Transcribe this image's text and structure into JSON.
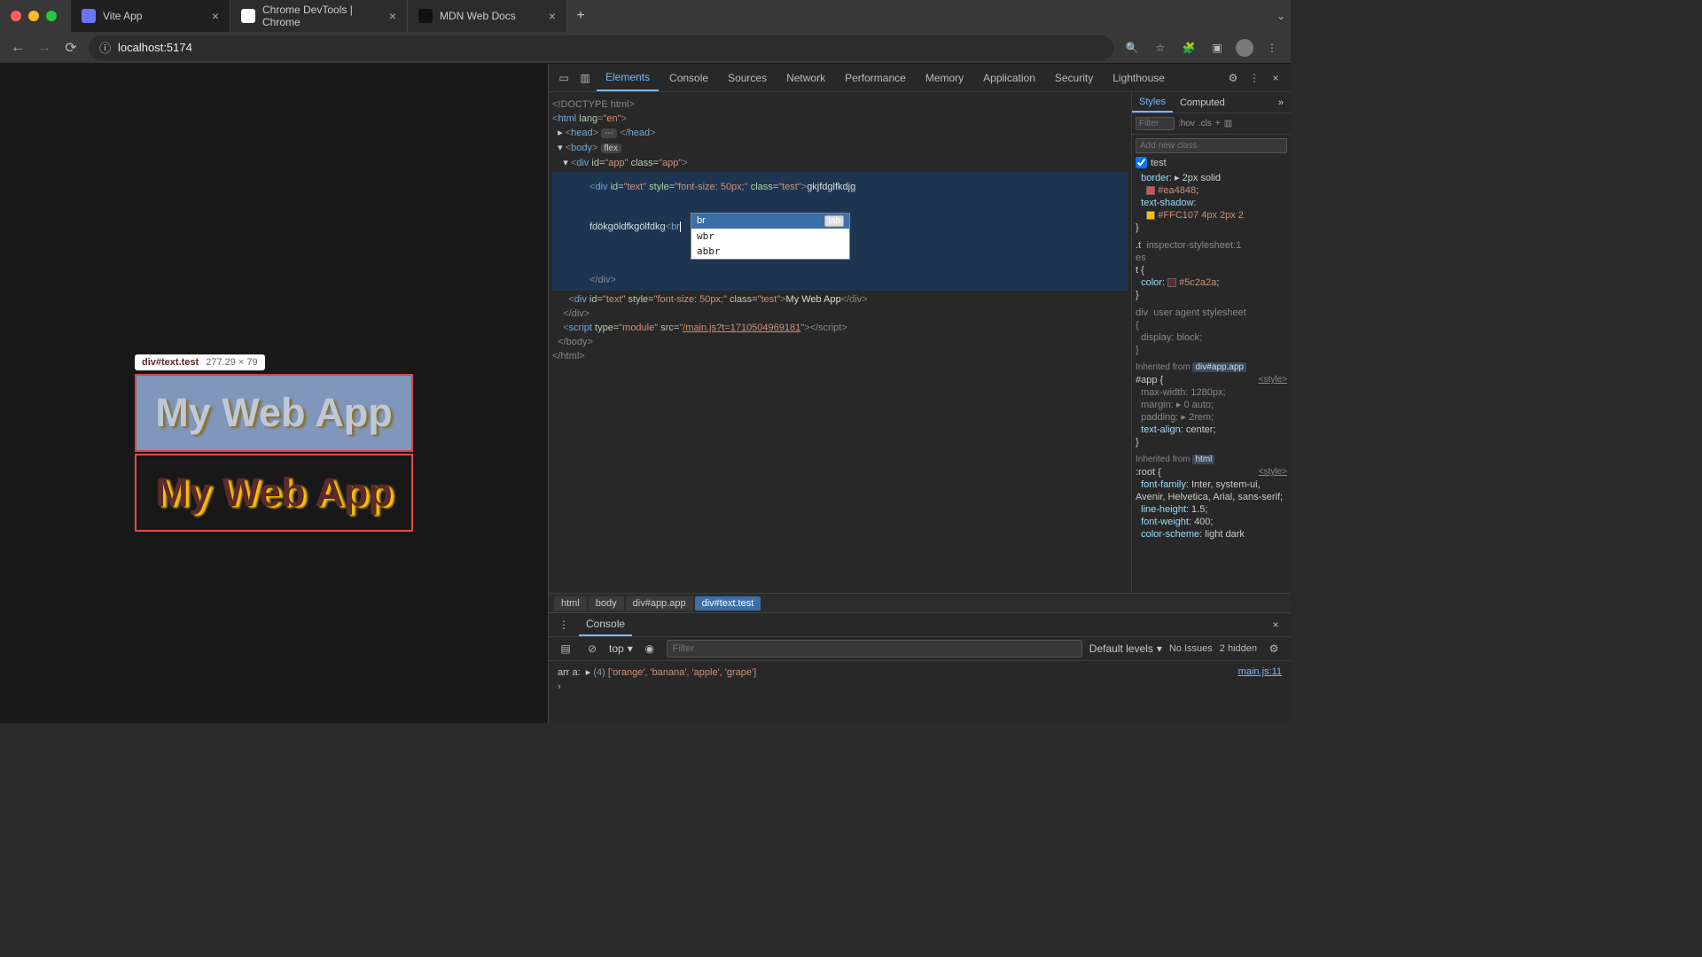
{
  "browser": {
    "tabs": [
      {
        "title": "Vite App",
        "favicon": "#6875f5"
      },
      {
        "title": "Chrome DevTools | Chrome",
        "favicon": "#66aa66"
      },
      {
        "title": "MDN Web Docs",
        "favicon": "#222"
      }
    ],
    "url": "localhost:5174"
  },
  "page_preview": {
    "hover_selector": "div#text.test",
    "hover_dims": "277.29 × 79",
    "text1": "My Web App",
    "text2": "My Web App"
  },
  "devtools": {
    "panels": [
      "Elements",
      "Console",
      "Sources",
      "Network",
      "Performance",
      "Memory",
      "Application",
      "Security",
      "Lighthouse"
    ],
    "active_panel": "Elements",
    "dom": {
      "doctype": "<!DOCTYPE html>",
      "html_open": "html",
      "html_lang": "en",
      "head_label": "head",
      "body_label": "body",
      "flex_badge": "flex",
      "app_id": "app",
      "app_class": "app",
      "text_id": "text",
      "text_style": "font-size: 50px;",
      "text_class": "test",
      "text_content_1": "gkjfdglfkdjg",
      "edit_prefix": "fdökgöldfkgölfdkg",
      "edit_typed": "br",
      "close_div": "</div>",
      "second_text_content": "My Web App",
      "script_type": "module",
      "script_src": "/main.js?t=1710504969181"
    },
    "autocomplete": {
      "selected": "br",
      "opt2": "wbr",
      "opt3": "abbr",
      "hint": "tab"
    },
    "breadcrumbs": [
      "html",
      "body",
      "div#app.app",
      "div#text.test"
    ],
    "styles_sidebar": {
      "tabs": [
        "Styles",
        "Computed"
      ],
      "filter_placeholder": "Filter",
      "hov": ":hov",
      "cls": ".cls",
      "newclass_placeholder": "Add new class",
      "class_checkbox": "test",
      "rule_test": {
        "border_prop": "border",
        "border_val_a": "2px solid",
        "border_val_b": "#ea4848",
        "shadow_prop": "text-shadow",
        "shadow_val": "#FFC107 4px 2px 2"
      },
      "rule_t": {
        "selector": ".t",
        "source": "inspector-stylesheet:1",
        "es": "es",
        "color_prop": "color",
        "color_val": "#5c2a2a"
      },
      "rule_div": {
        "selector": "div",
        "note": "user agent stylesheet",
        "prop": "display",
        "val": "block"
      },
      "inherited_app": {
        "label": "Inherited from",
        "link": "div#app.app",
        "selector": "#app",
        "source": "<style>",
        "mw_prop": "max-width",
        "mw_val": "1280px",
        "mg_prop": "margin",
        "mg_val": "0 auto",
        "pd_prop": "padding",
        "pd_val": "2rem",
        "ta_prop": "text-align",
        "ta_val": "center"
      },
      "inherited_html": {
        "label": "Inherited from",
        "link": "html",
        "selector": ":root",
        "source": "<style>",
        "ff_prop": "font-family",
        "ff_val": "Inter, system-ui, Avenir, Helvetica, Arial, sans-serif",
        "lh_prop": "line-height",
        "lh_val": "1.5",
        "fw_prop": "font-weight",
        "fw_val": "400",
        "cs_prop": "color-scheme",
        "cs_val": "light dark"
      }
    }
  },
  "console": {
    "title": "Console",
    "context": "top",
    "filter_placeholder": "Filter",
    "levels": "Default levels",
    "issues": "No Issues",
    "hidden": "2 hidden",
    "log_label": "arr a:",
    "log_len": "(4)",
    "log_items": "['orange', 'banana', 'apple', 'grape']",
    "src_link": "main.js:11"
  }
}
